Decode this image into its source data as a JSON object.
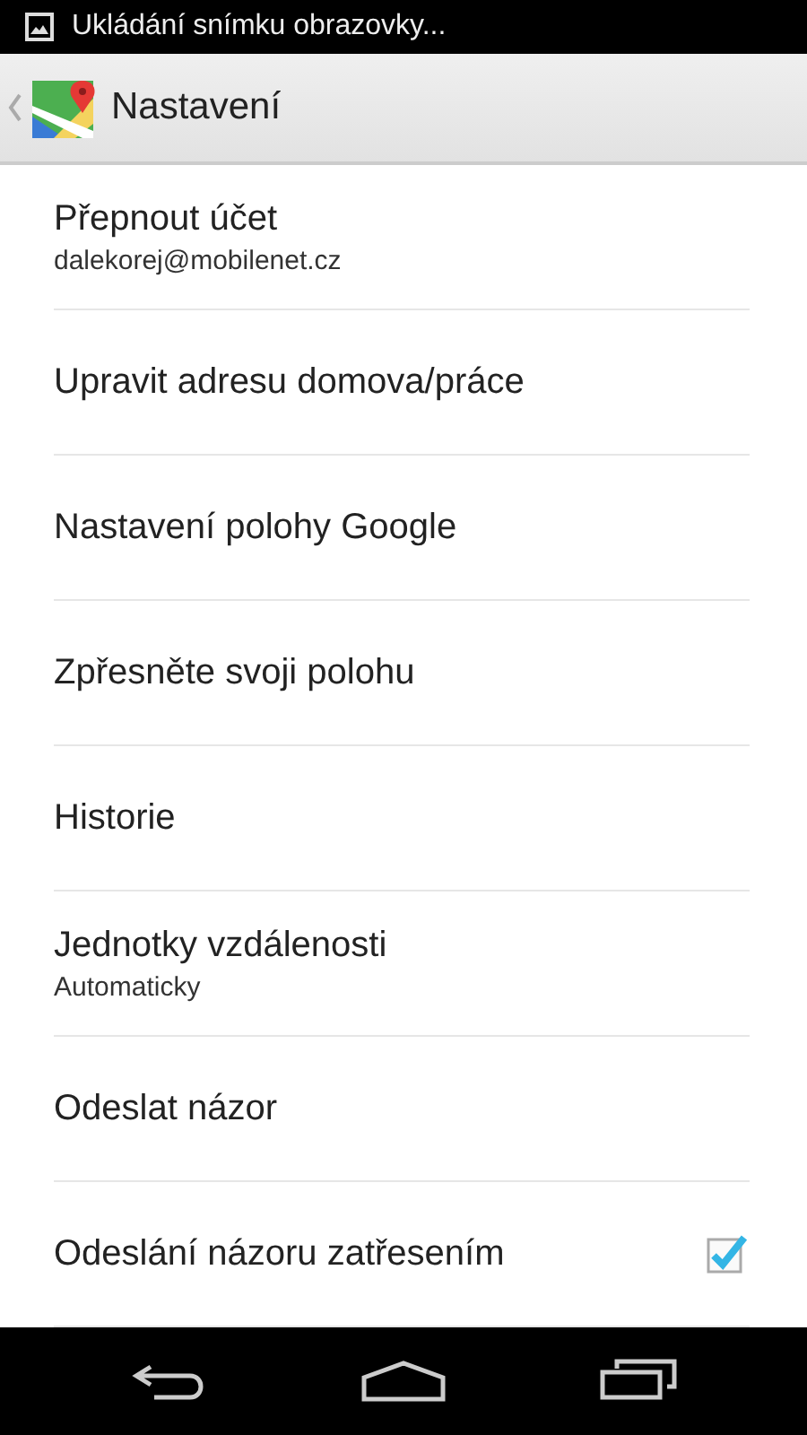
{
  "status_bar": {
    "notification": "Ukládání snímku obrazovky..."
  },
  "action_bar": {
    "title": "Nastavení"
  },
  "settings": [
    {
      "kind": "text",
      "title": "Přepnout účet",
      "summary": "dalekorej@mobilenet.cz"
    },
    {
      "kind": "text",
      "title": "Upravit adresu domova/práce"
    },
    {
      "kind": "text",
      "title": "Nastavení polohy Google"
    },
    {
      "kind": "text",
      "title": "Zpřesněte svoji polohu"
    },
    {
      "kind": "text",
      "title": "Historie"
    },
    {
      "kind": "text",
      "title": "Jednotky vzdálenosti",
      "summary": "Automaticky"
    },
    {
      "kind": "text",
      "title": "Odeslat názor"
    },
    {
      "kind": "checkbox",
      "title": "Odeslání názoru zatřesením",
      "checked": true
    }
  ]
}
